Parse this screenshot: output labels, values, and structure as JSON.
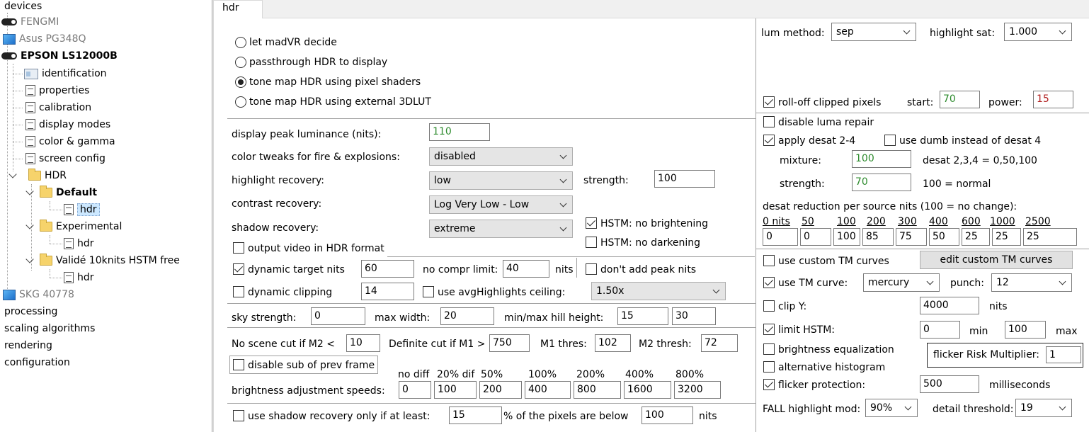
{
  "tree": {
    "root": "devices",
    "items": [
      {
        "label": "FENGMI"
      },
      {
        "label": "Asus PG348Q"
      },
      {
        "label": "EPSON LS12000B"
      },
      {
        "label": "identification"
      },
      {
        "label": "properties"
      },
      {
        "label": "calibration"
      },
      {
        "label": "display modes"
      },
      {
        "label": "color & gamma"
      },
      {
        "label": "screen config"
      },
      {
        "label": "HDR"
      },
      {
        "label": "Default"
      },
      {
        "label": "hdr"
      },
      {
        "label": "Experimental"
      },
      {
        "label": "hdr"
      },
      {
        "label": "Validé 10knits HSTM free"
      },
      {
        "label": "hdr"
      },
      {
        "label": "SKG 40778"
      }
    ],
    "sections": [
      "processing",
      "scaling algorithms",
      "rendering",
      "configuration"
    ]
  },
  "tab": {
    "label": "hdr"
  },
  "modes": [
    {
      "label": "let madVR decide",
      "selected": false
    },
    {
      "label": "passthrough HDR to display",
      "selected": false
    },
    {
      "label": "tone map HDR using pixel shaders",
      "selected": true
    },
    {
      "label": "tone map HDR using external 3DLUT",
      "selected": false
    }
  ],
  "left": {
    "peak_label": "display peak luminance (nits):",
    "peak_value": "110",
    "fire_label": "color tweaks for fire & explosions:",
    "fire_value": "disabled",
    "hl_label": "highlight recovery:",
    "hl_value": "low",
    "hl_strength_label": "strength:",
    "hl_strength_value": "100",
    "contrast_label": "contrast recovery:",
    "contrast_value": "Log Very Low - Low",
    "shadow_label": "shadow recovery:",
    "shadow_value": "extreme",
    "hstm_bright": "HSTM: no brightening",
    "hstm_dark": "HSTM: no darkening",
    "output_hdr": "output video in HDR format",
    "dyn_target": "dynamic target nits",
    "dyn_target_value": "60",
    "no_compr_label": "no compr limit:",
    "no_compr_value": "40",
    "nits": "nits",
    "dont_add_peak": "don't add peak nits",
    "dyn_clip": "dynamic clipping",
    "dyn_clip_value": "14",
    "avg_ceiling": "use avgHighlights ceiling:",
    "avg_ceiling_value": "1.50x",
    "sky_label": "sky strength:",
    "sky_value": "0",
    "maxw_label": "max width:",
    "maxw_value": "20",
    "hill_label": "min/max hill height:",
    "hill_min": "15",
    "hill_max": "30",
    "noscene_label": "No scene cut if M2 <",
    "noscene_value": "10",
    "defcut_label": "Definite cut if M1 >",
    "defcut_value": "750",
    "m1_label": "M1 thres:",
    "m1_value": "102",
    "m2_label": "M2 thresh:",
    "m2_value": "72",
    "disable_sub": "disable sub of prev frame",
    "speed_headers": [
      "no diff",
      "20% dif",
      "50%",
      "100%",
      "200%",
      "400%",
      "800%"
    ],
    "speed_label": "brightness adjustment speeds:",
    "speed_values": [
      "0",
      "100",
      "200",
      "400",
      "800",
      "1600",
      "3200"
    ],
    "shadow_only": "use shadow recovery only if at least:",
    "shadow_only_value": "15",
    "pixels_below": "% of the pixels are below",
    "pixels_below_value": "100",
    "nits2": "nits"
  },
  "right": {
    "lum_label": "lum method:",
    "lum_value": "sep",
    "hsat_label": "highlight sat:",
    "hsat_value": "1.000",
    "rolloff": "roll-off clipped pixels",
    "start_label": "start:",
    "start_value": "70",
    "power_label": "power:",
    "power_value": "15",
    "luma_repair": "disable luma repair",
    "desat24": "apply desat 2-4",
    "dumb": "use dumb instead of desat 4",
    "mixture_label": "mixture:",
    "mixture_value": "100",
    "desat_note": "desat 2,3,4 = 0,50,100",
    "strength_label": "strength:",
    "strength_value": "70",
    "strength_note": "100 = normal",
    "desat_red": "desat reduction per source nits (100 = no change):",
    "nits_headers": [
      "0 nits",
      "50",
      "100",
      "200",
      "300",
      "400",
      "600",
      "1000",
      "2500"
    ],
    "nits_values": [
      "0",
      "0",
      "100",
      "85",
      "75",
      "50",
      "25",
      "25",
      "25"
    ],
    "custom_tm": "use custom TM curves",
    "edit_custom": "edit custom TM curves",
    "tm_curve": "use TM curve:",
    "tm_value": "mercury",
    "punch_label": "punch:",
    "punch_value": "12",
    "clipy": "clip Y:",
    "clipy_value": "4000",
    "nits": "nits",
    "limit_hstm": "limit HSTM:",
    "limit_min": "0",
    "min_label": "min",
    "limit_max": "100",
    "max_label": "max",
    "bright_eq": "brightness equalization",
    "flicker_mult_label": "flicker Risk Multiplier:",
    "flicker_mult_value": "1",
    "alt_hist": "alternative histogram",
    "flicker_prot": "flicker protection:",
    "flicker_value": "500",
    "ms": "milliseconds",
    "fall_label": "FALL highlight mod:",
    "fall_value": "90%",
    "detail_label": "detail threshold:",
    "detail_value": "19"
  }
}
